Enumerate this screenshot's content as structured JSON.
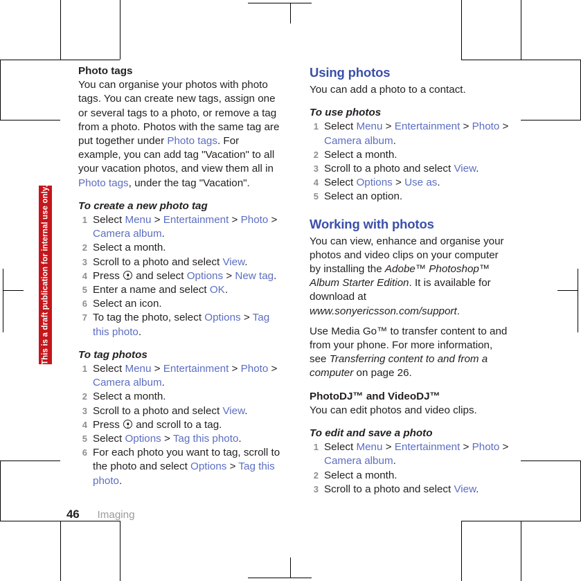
{
  "page": {
    "number": "46",
    "chapter": "Imaging",
    "watermark": "This is a draft publication for internal use only.",
    "watermark_color": "#c4161c",
    "heading_color": "#3b4fa8",
    "link_color": "#5c6ec2",
    "body_color": "#231f20",
    "number_color": "#8e8e90"
  },
  "left_column": {
    "photo_tags": {
      "title": "Photo tags",
      "paragraph_part1": "You can organise your photos with photo tags. You can create new tags, assign one or several tags to a photo, or remove a tag from a photo. Photos with the same tag are put together under ",
      "link1": "Photo tags",
      "paragraph_part2": ". For example, you can add tag \"Vacation\" to all your vacation photos, and view them all in ",
      "link2": "Photo tags",
      "paragraph_part3": ", under the tag \"Vacation\"."
    },
    "create_tag": {
      "title": "To create a new photo tag",
      "steps": [
        {
          "pre": "Select ",
          "runs": [
            "Menu",
            "Entertainment",
            "Photo",
            "Camera album"
          ],
          "post": "."
        },
        {
          "text": "Select a month."
        },
        {
          "pre": "Scroll to a photo and select ",
          "runs": [
            "View"
          ],
          "post": "."
        },
        {
          "pre": "Press ",
          "icon": "select-key-icon",
          "mid": " and select ",
          "runs": [
            "Options",
            "New tag"
          ],
          "post": "."
        },
        {
          "pre": "Enter a name and select ",
          "runs": [
            "OK"
          ],
          "post": "."
        },
        {
          "text": "Select an icon."
        },
        {
          "pre": "To tag the photo, select ",
          "runs": [
            "Options",
            "Tag this photo"
          ],
          "post": "."
        }
      ]
    },
    "tag_photos": {
      "title": "To tag photos",
      "steps": [
        {
          "pre": "Select ",
          "runs": [
            "Menu",
            "Entertainment",
            "Photo",
            "Camera album"
          ],
          "post": "."
        },
        {
          "text": "Select a month."
        },
        {
          "pre": "Scroll to a photo and select ",
          "runs": [
            "View"
          ],
          "post": "."
        },
        {
          "pre": "Press ",
          "icon": "select-key-icon",
          "mid": " and scroll to a tag.",
          "runs": [],
          "post": ""
        },
        {
          "pre": "Select ",
          "runs": [
            "Options",
            "Tag this photo"
          ],
          "post": "."
        },
        {
          "pre": "For each photo you want to tag, scroll to the photo and select ",
          "runs": [
            "Options",
            "Tag this photo"
          ],
          "post": "."
        }
      ]
    }
  },
  "right_column": {
    "using_photos": {
      "title": "Using photos",
      "paragraph": "You can add a photo to a contact.",
      "procedure_title": "To use photos",
      "steps": [
        {
          "pre": "Select ",
          "runs": [
            "Menu",
            "Entertainment",
            "Photo",
            "Camera album"
          ],
          "post": "."
        },
        {
          "text": "Select a month."
        },
        {
          "pre": "Scroll to a photo and select ",
          "runs": [
            "View"
          ],
          "post": "."
        },
        {
          "pre": "Select ",
          "runs": [
            "Options",
            "Use as"
          ],
          "post": "."
        },
        {
          "text": "Select an option."
        }
      ]
    },
    "working_with_photos": {
      "title": "Working with photos",
      "para1_part1": "You can view, enhance and organise your photos and video clips on your computer by installing the ",
      "para1_italic1": "Adobe™ Photoshop™ Album Starter Edition",
      "para1_part2": ". It is available for download at ",
      "para1_italic2": "www.sonyericsson.com/support",
      "para1_part3": ".",
      "para2_part1": "Use Media Go™ to transfer content to and from your phone. For more information, see ",
      "para2_italic": "Transferring content to and from a computer",
      "para2_part2": " on page 26.",
      "subsection_title": "PhotoDJ™ and VideoDJ™",
      "subsection_para": "You can edit photos and video clips.",
      "procedure_title": "To edit and save a photo",
      "steps": [
        {
          "pre": "Select ",
          "runs": [
            "Menu",
            "Entertainment",
            "Photo",
            "Camera album"
          ],
          "post": "."
        },
        {
          "text": "Select a month."
        },
        {
          "pre": "Scroll to a photo and select ",
          "runs": [
            "View"
          ],
          "post": "."
        }
      ]
    }
  }
}
